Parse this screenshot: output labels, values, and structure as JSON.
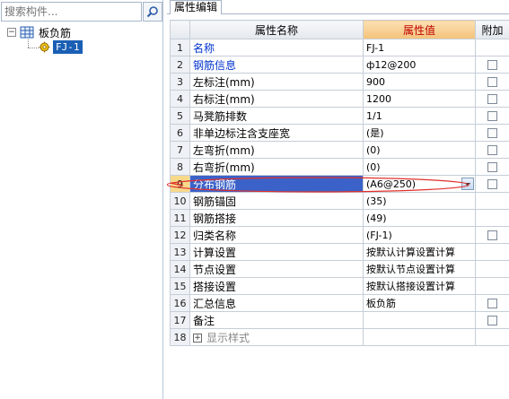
{
  "search": {
    "placeholder": "搜索构件..."
  },
  "tree": {
    "root": {
      "label": "板负筋",
      "expand": "⊟"
    },
    "child": {
      "label": "FJ-1"
    }
  },
  "tabs": [
    {
      "label": "属性编辑"
    }
  ],
  "grid": {
    "headers": {
      "name": "属性名称",
      "value": "属性值",
      "add": "附加"
    },
    "rows": [
      {
        "idx": "1",
        "name": "名称",
        "value": "FJ-1",
        "checkbox": false,
        "style": "blue"
      },
      {
        "idx": "2",
        "name": "钢筋信息",
        "value": "ф12@200",
        "checkbox": true,
        "style": "blue"
      },
      {
        "idx": "3",
        "name": "左标注(mm)",
        "value": "900",
        "checkbox": true,
        "style": ""
      },
      {
        "idx": "4",
        "name": "右标注(mm)",
        "value": "1200",
        "checkbox": true,
        "style": ""
      },
      {
        "idx": "5",
        "name": "马凳筋排数",
        "value": "1/1",
        "checkbox": true,
        "style": ""
      },
      {
        "idx": "6",
        "name": "非单边标注含支座宽",
        "value": "(是)",
        "checkbox": true,
        "style": ""
      },
      {
        "idx": "7",
        "name": "左弯折(mm)",
        "value": "(0)",
        "checkbox": true,
        "style": ""
      },
      {
        "idx": "8",
        "name": "右弯折(mm)",
        "value": "(0)",
        "checkbox": true,
        "style": ""
      },
      {
        "idx": "9",
        "name": "分布钢筋",
        "value": "(A6@250)",
        "checkbox": true,
        "style": "",
        "selected": true
      },
      {
        "idx": "10",
        "name": "钢筋锚固",
        "value": "(35)",
        "checkbox": false,
        "style": ""
      },
      {
        "idx": "11",
        "name": "钢筋搭接",
        "value": "(49)",
        "checkbox": false,
        "style": ""
      },
      {
        "idx": "12",
        "name": "归类名称",
        "value": "(FJ-1)",
        "checkbox": true,
        "style": ""
      },
      {
        "idx": "13",
        "name": "计算设置",
        "value": "按默认计算设置计算",
        "checkbox": false,
        "style": ""
      },
      {
        "idx": "14",
        "name": "节点设置",
        "value": "按默认节点设置计算",
        "checkbox": false,
        "style": ""
      },
      {
        "idx": "15",
        "name": "搭接设置",
        "value": "按默认搭接设置计算",
        "checkbox": false,
        "style": ""
      },
      {
        "idx": "16",
        "name": "汇总信息",
        "value": "板负筋",
        "checkbox": true,
        "style": ""
      },
      {
        "idx": "17",
        "name": "备注",
        "value": "",
        "checkbox": true,
        "style": ""
      },
      {
        "idx": "18",
        "name": "显示样式",
        "value": "",
        "checkbox": false,
        "style": "gray",
        "expandable": true
      }
    ]
  },
  "colors": {
    "selection": "#3b62c8",
    "annotation": "#e0302c",
    "value_header": "#c00000"
  }
}
